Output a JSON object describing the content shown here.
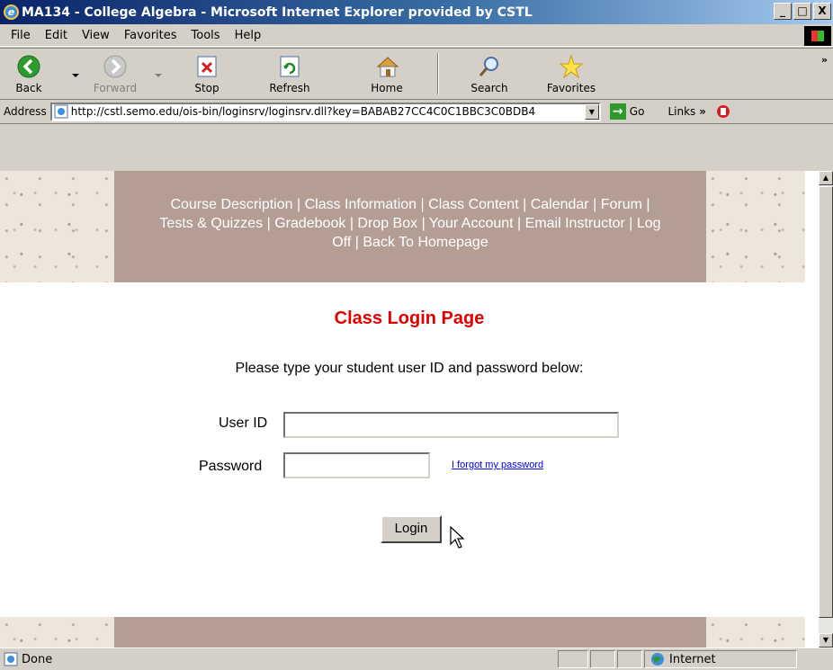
{
  "window": {
    "title": "MA134 - College Algebra - Microsoft Internet Explorer provided by CSTL",
    "min": "_",
    "max": "□",
    "close": "X"
  },
  "menu": [
    "File",
    "Edit",
    "View",
    "Favorites",
    "Tools",
    "Help"
  ],
  "toolbar": {
    "back": "Back",
    "forward": "Forward",
    "stop": "Stop",
    "refresh": "Refresh",
    "home": "Home",
    "search": "Search",
    "favorites": "Favorites",
    "more": "»"
  },
  "address": {
    "label": "Address",
    "url": "http://cstl.semo.edu/ois-bin/loginsrv/loginsrv.dll?key=BABAB27CC4C0C1BBC3C0BDB4",
    "go": "Go",
    "links": "Links",
    "links_more": "»"
  },
  "nav": {
    "course_description": "Course Description",
    "class_information": "Class Information",
    "class_content": "Class Content",
    "calendar": "Calendar",
    "forum": "Forum",
    "tests_quizzes": "Tests & Quizzes",
    "gradebook": "Gradebook",
    "drop_box": "Drop Box",
    "your_account": "Your Account",
    "email_instructor": "Email Instructor",
    "log": "Log",
    "off": "Off",
    "back_home": "Back To Homepage",
    "sep": "|"
  },
  "login": {
    "heading": "Class Login Page",
    "instructions": "Please type your student user ID and password below:",
    "user_id_label": "User ID",
    "user_id_value": "",
    "password_label": "Password",
    "password_value": "",
    "forgot": "I forgot my password",
    "button": "Login"
  },
  "status": {
    "text": "Done",
    "zone": "Internet"
  },
  "colors": {
    "banner": "#b49d92",
    "heading": "#e30000",
    "link": "#0000ee"
  }
}
